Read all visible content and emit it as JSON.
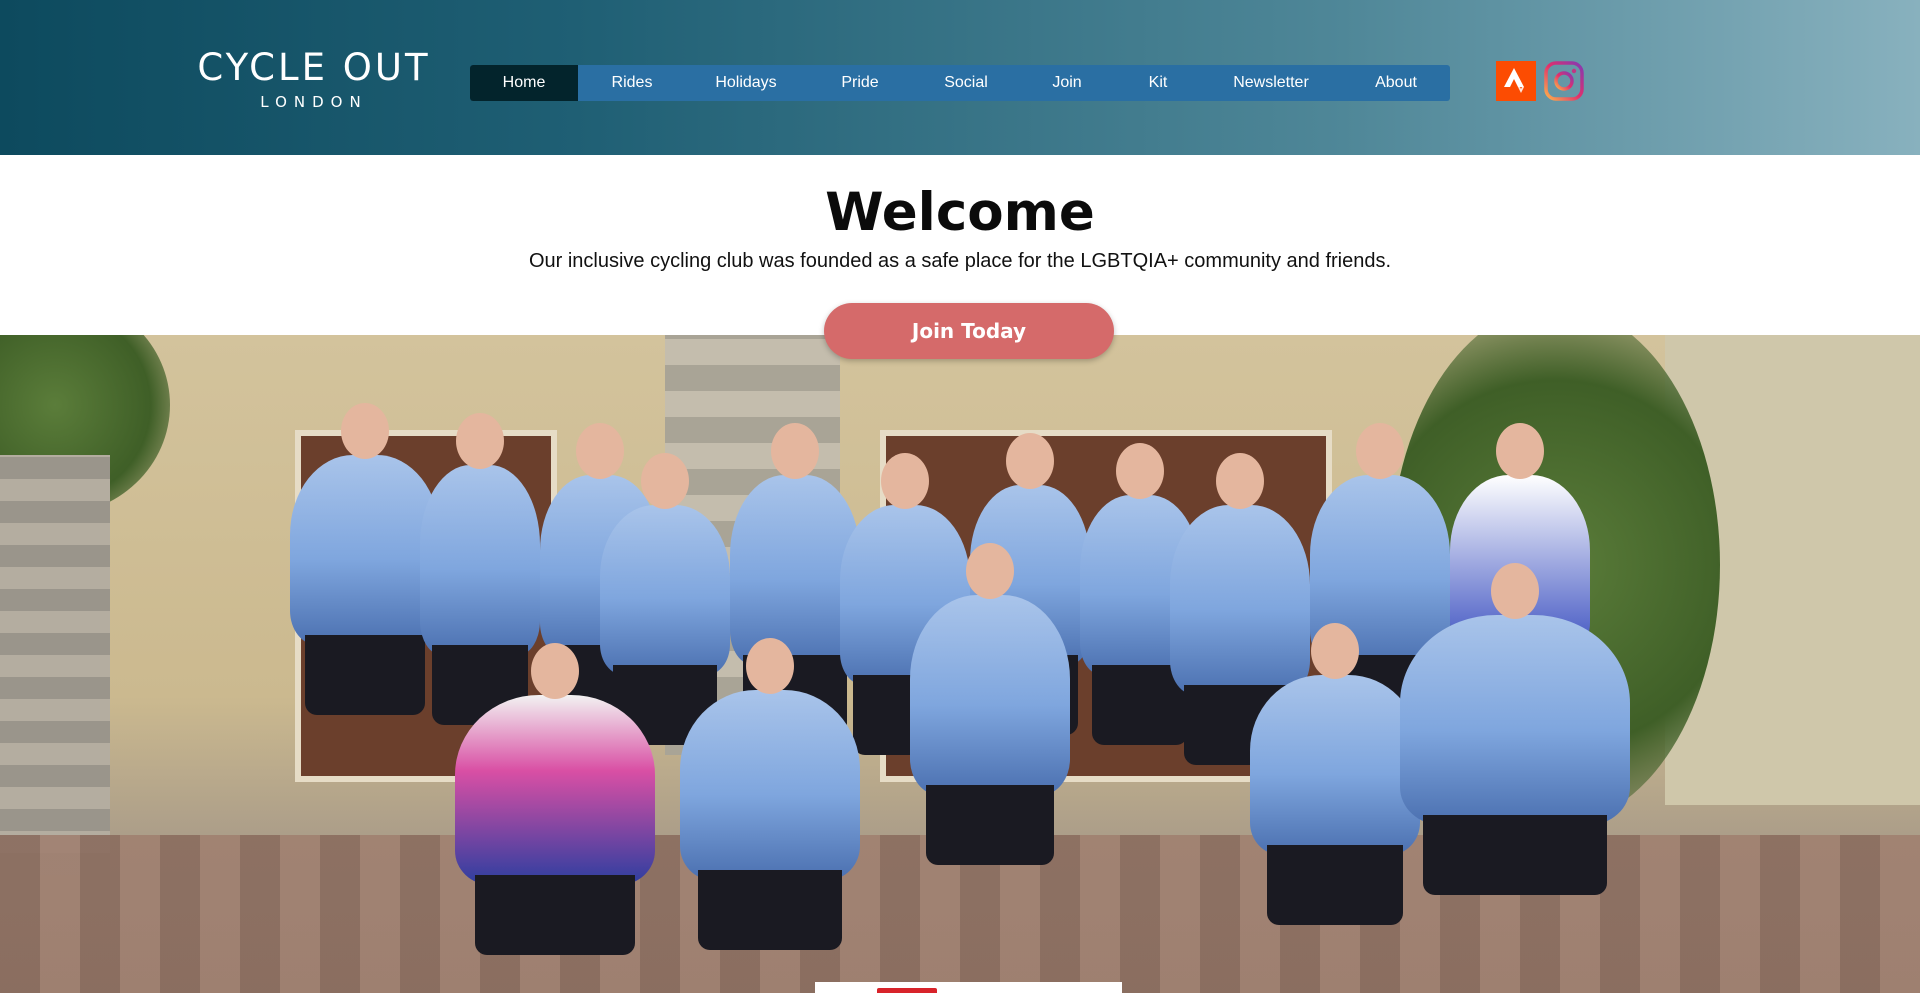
{
  "brand": {
    "name_main": "CYCLE OUT",
    "name_sub": "LONDON"
  },
  "nav": {
    "items": [
      {
        "label": "Home",
        "active": true
      },
      {
        "label": "Rides"
      },
      {
        "label": "Holidays"
      },
      {
        "label": "Pride"
      },
      {
        "label": "Social"
      },
      {
        "label": "Join"
      },
      {
        "label": "Kit"
      },
      {
        "label": "Newsletter"
      },
      {
        "label": "About"
      }
    ]
  },
  "social": {
    "strava_icon": "strava-icon",
    "instagram_icon": "instagram-icon"
  },
  "welcome": {
    "title": "Welcome",
    "text": "Our inclusive cycling club was founded as a safe place for the LGBTQIA+ community and friends.",
    "button": "Join Today"
  },
  "colors": {
    "header_start": "#0d4a5e",
    "header_end": "#88b1be",
    "nav_bar": "#2a6fa3",
    "nav_active": "#03242c",
    "button": "#d56a6a",
    "strava": "#fc4c02"
  }
}
